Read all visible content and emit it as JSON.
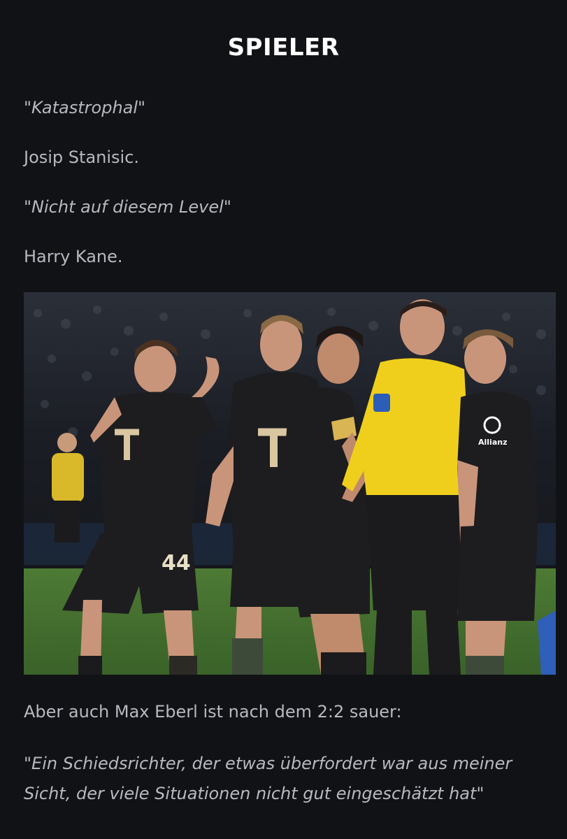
{
  "header": {
    "title": "SPIELER"
  },
  "article": {
    "quote_1": "\"Katastrophal\"",
    "attribution_1": "Josip Stanisic.",
    "quote_2": "\"Nicht auf diesem Level\"",
    "attribution_2": "Harry Kane.",
    "intro_text": "Aber auch Max Eberl ist nach dem 2:2 sauer:",
    "quote_3": "\"Ein Schiedsrichter, der etwas überfordert war aus meiner Sicht, der viele Situationen nicht gut eingeschätzt hat\""
  },
  "photo": {
    "jersey_number": "44",
    "sponsor_letter": "T",
    "partner_logo_text": "Allianz",
    "colors": {
      "pitch": "#3f6a2d",
      "kit": "#1d1d1f",
      "referee_shirt": "#f0cf1c",
      "kit_trim": "#c4a882"
    }
  }
}
